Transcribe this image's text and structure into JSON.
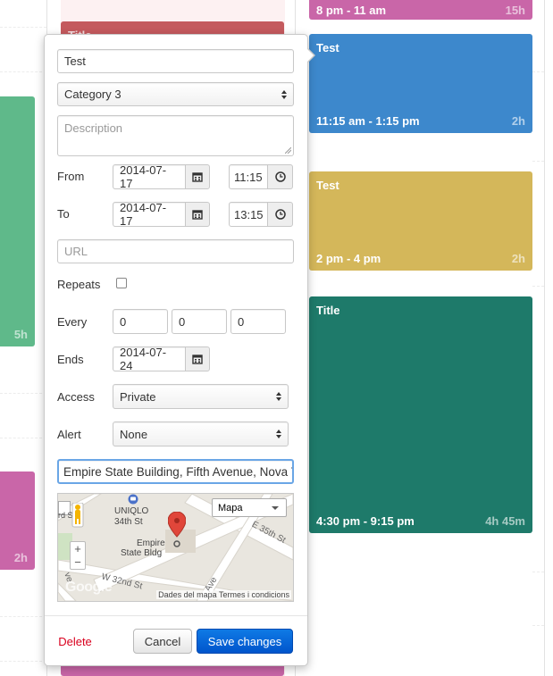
{
  "calendar": {
    "events_right": [
      {
        "title": "8 pm - 11 am",
        "time": "",
        "duration": "15h",
        "color": "#c966a8"
      },
      {
        "title": "Test",
        "time": "11:15 am - 1:15 pm",
        "duration": "2h",
        "color": "#3d88cc"
      },
      {
        "title": "Test",
        "time": "2 pm - 4 pm",
        "duration": "2h",
        "color": "#d4b75a"
      },
      {
        "title": "Title",
        "time": "4:30 pm - 9:15 pm",
        "duration": "4h 45m",
        "color": "#1e7a6a"
      }
    ],
    "events_left": [
      {
        "duration": "5h",
        "color": "#5fb98a"
      },
      {
        "duration": "2h",
        "color": "#c966a8"
      }
    ],
    "behind_title": "Title"
  },
  "form": {
    "title_value": "Test",
    "category_value": "Category 3",
    "description_placeholder": "Description",
    "from_label": "From",
    "from_date": "2014-07-17",
    "from_time": "11:15",
    "to_label": "To",
    "to_date": "2014-07-17",
    "to_time": "13:15",
    "url_placeholder": "URL",
    "repeats_label": "Repeats",
    "every_label": "Every",
    "every_values": [
      "0",
      "0",
      "0"
    ],
    "ends_label": "Ends",
    "ends_date": "2014-07-24",
    "access_label": "Access",
    "access_value": "Private",
    "alert_label": "Alert",
    "alert_value": "None",
    "location_value": "Empire State Building, Fifth Avenue, Nova Y"
  },
  "map": {
    "type_select": "Mapa",
    "label_uniqlo": "UNIQLO",
    "label_34th": "34th St",
    "label_empire_1": "Empire",
    "label_empire_2": "State Bldg",
    "label_e35": "E 35th St",
    "label_w32": "W 32nd St",
    "label_rd": "rd St",
    "label_ave": "Ave",
    "label_ave2": "ve",
    "logo": "Google",
    "terms": "Dades del mapa  Termes i condicions",
    "zoom_in": "+",
    "zoom_out": "−"
  },
  "actions": {
    "delete_label": "Delete",
    "cancel_label": "Cancel",
    "save_label": "Save changes"
  }
}
